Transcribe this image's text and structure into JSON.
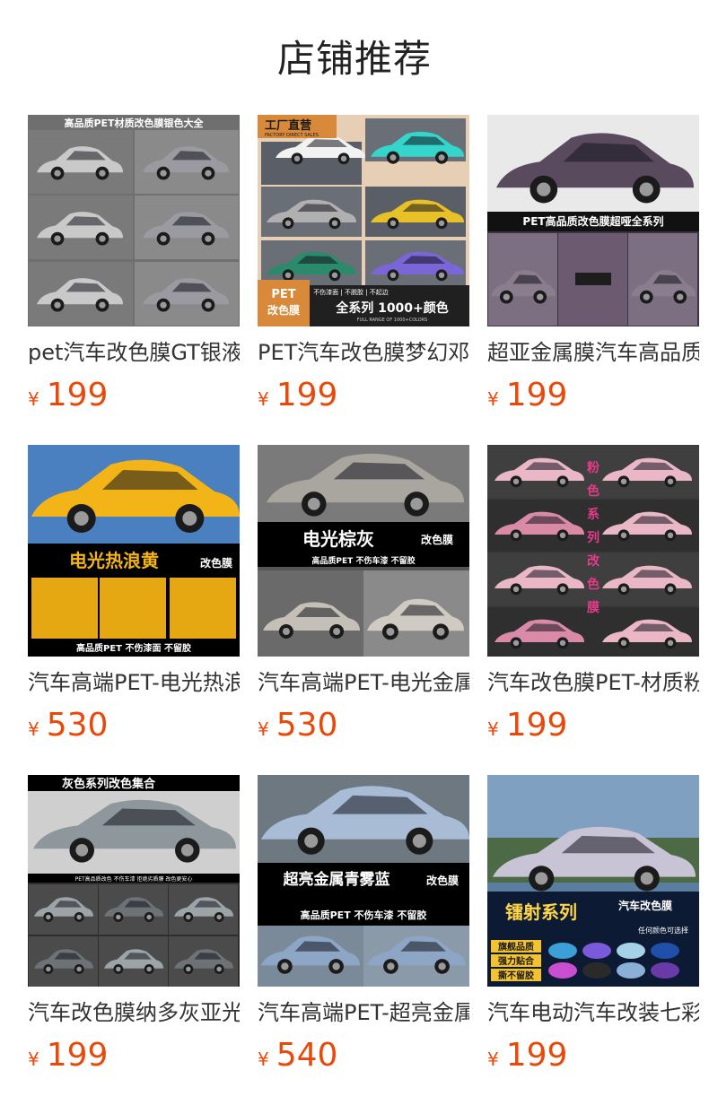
{
  "header": {
    "title": "店铺推荐"
  },
  "currency": "¥",
  "products": [
    {
      "title": "pet汽车改色膜GT银液态金属银",
      "price": "199",
      "banner_top": "高品质PET材质改色膜银色大全",
      "theme": {
        "bg": "#6f6f6f",
        "car1": "#c9c9c9",
        "car2": "#9a9aa0",
        "accent": "#1a1a1a"
      }
    },
    {
      "title": "PET汽车改色膜梦幻邓布利多紫",
      "price": "199",
      "banner_top": "工厂直营",
      "banner_top_sub": "FACTORY DIRECT SALES",
      "banner_bottom_left": "PET 改色膜",
      "banner_bottom_tags": "不伤漆面 | 不脱胶 | 不起边",
      "banner_bottom_right": "全系列 1000+颜色",
      "banner_bottom_sub": "FULL RANGE OF 1000+COLORS",
      "theme": {
        "bg": "#4b4e54",
        "car1": "#f2f2f2",
        "car2": "#34d6cc",
        "accent": "#e08a3c"
      }
    },
    {
      "title": "超亚金属膜汽车高品质PET改色",
      "price": "199",
      "banner_mid": "PET高品质改色膜超哑全系列",
      "theme": {
        "bg": "#3c3440",
        "car1": "#5a4a5e",
        "car2": "#8a7d8e",
        "accent": "#111111"
      }
    },
    {
      "title": "汽车高端PET-电光热浪黄改色膜",
      "price": "530",
      "banner_mid": "电光热浪黄",
      "banner_mid_tag": "改色膜",
      "banner_bottom": "高品质PET   不伤漆面   不留胶",
      "theme": {
        "bg": "#3a6fb0",
        "car1": "#f2b417",
        "car2": "#e6a812",
        "accent": "#000000"
      }
    },
    {
      "title": "汽车高端PET-电光金属棕灰改色",
      "price": "530",
      "banner_mid": "电光棕灰",
      "banner_mid_tag": "改色膜",
      "banner_tags": "高品质PET   不伤车漆   不留胶",
      "theme": {
        "bg": "#555555",
        "car1": "#a9a6a0",
        "car2": "#c4c0b8",
        "accent": "#000000"
      }
    },
    {
      "title": "汽车改色膜PET-材质粉色系列",
      "price": "199",
      "side_text": "粉色系列改色膜",
      "theme": {
        "bg": "#3a3a3a",
        "car1": "#e9b7c6",
        "car2": "#d88aa6",
        "accent": "#e63b8a"
      }
    },
    {
      "title": "汽车改色膜纳多灰亚光灰系列",
      "price": "199",
      "banner_top": "灰色系列改色集合",
      "banner_tags": "PET高品质改色   不伤车漆   拒绝劣质膜   改色更安心",
      "theme": {
        "bg": "#2e2e2e",
        "car1": "#8e979c",
        "car2": "#6c7276",
        "accent": "#000000"
      }
    },
    {
      "title": "汽车高端PET-超亮金属青雾蓝",
      "price": "540",
      "banner_mid": "超亮金属青雾蓝",
      "banner_mid_tag": "改色膜",
      "banner_tags": "高品质PET   不伤车漆   不留胶",
      "theme": {
        "bg": "#5d6870",
        "car1": "#a9bcd6",
        "car2": "#8ea6c6",
        "accent": "#000000"
      }
    },
    {
      "title": "汽车电动汽车改装七彩镭射改色",
      "price": "199",
      "banner_mid": "镭射系列",
      "banner_mid_tag": "汽车改色膜",
      "banner_mid_sub": "任何颜色可选择",
      "banner_tags": "旗舰品质 强力贴合 撕不留胶",
      "theme": {
        "bg": "#5b7ea0",
        "car1": "#c9c3d6",
        "car2": "#7fc4d8",
        "accent": "#0d1a33"
      }
    }
  ]
}
